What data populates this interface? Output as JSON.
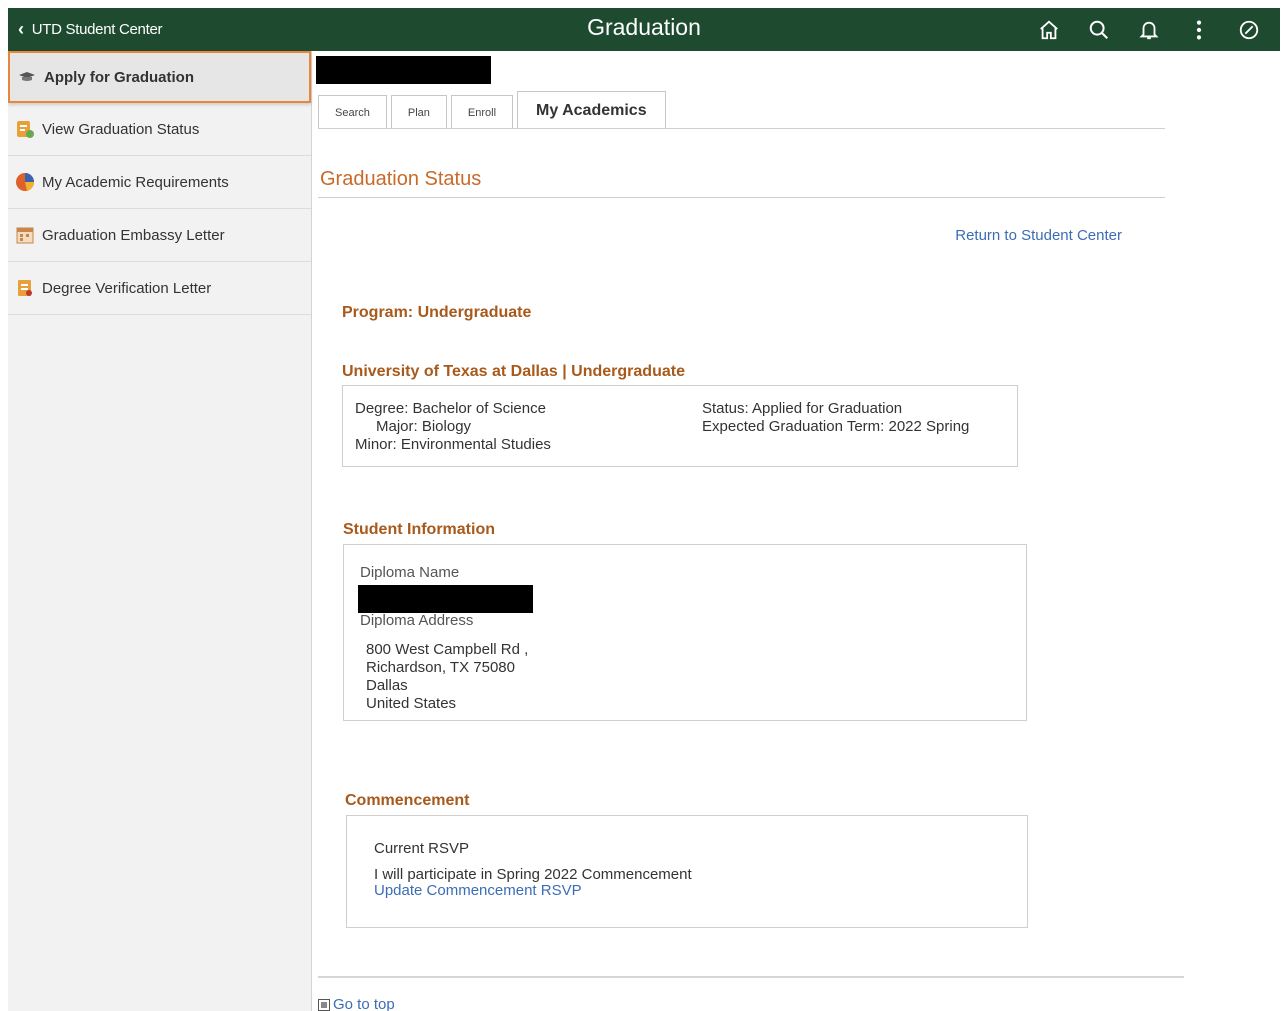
{
  "header": {
    "back_label": "UTD Student Center",
    "title": "Graduation",
    "icons": [
      "home-icon",
      "search-icon",
      "bell-icon",
      "more-icon",
      "compass-icon"
    ],
    "bg_color": "#1e4a30"
  },
  "sidebar": {
    "items": [
      {
        "label": "Apply for Graduation",
        "icon": "cap-icon",
        "active": true
      },
      {
        "label": "View Graduation Status",
        "icon": "document-check-icon"
      },
      {
        "label": "My Academic Requirements",
        "icon": "pie-chart-icon"
      },
      {
        "label": "Graduation Embassy Letter",
        "icon": "calendar-letter-icon"
      },
      {
        "label": "Degree Verification Letter",
        "icon": "certificate-icon"
      }
    ],
    "active_border_color": "#e8863e"
  },
  "tabs": [
    {
      "label": "Search"
    },
    {
      "label": "Plan"
    },
    {
      "label": "Enroll"
    },
    {
      "label": "My Academics",
      "active": true
    }
  ],
  "main": {
    "section_title": "Graduation Status",
    "return_link": "Return to Student Center",
    "program_heading": "Program: Undergraduate",
    "institution_heading": "University of Texas at Dallas | Undergraduate",
    "degree": {
      "degree": "Degree: Bachelor of Science",
      "major": "Major: Biology",
      "minor": "Minor: Environmental Studies",
      "status": "Status: Applied for Graduation",
      "expected_term": "Expected Graduation Term: 2022 Spring"
    },
    "student_info": {
      "heading": "Student Information",
      "diploma_name_label": "Diploma Name",
      "diploma_address_label": "Diploma Address",
      "address_lines": [
        "800 West Campbell Rd ,",
        "Richardson, TX 75080",
        "Dallas",
        "United States"
      ]
    },
    "commencement": {
      "heading": "Commencement",
      "current_rsvp_label": "Current RSVP",
      "rsvp_text": "I will participate in Spring 2022 Commencement",
      "update_link": "Update Commencement RSVP"
    },
    "go_to_top": "Go to top",
    "accent_color": "#c86a2a",
    "link_color": "#3b6db5"
  }
}
